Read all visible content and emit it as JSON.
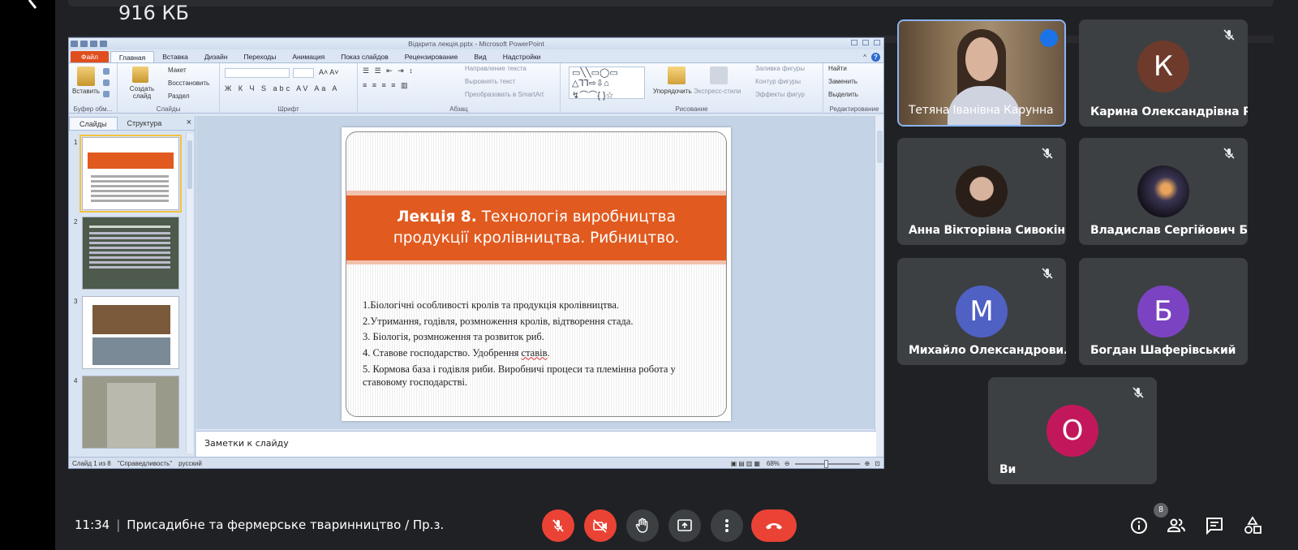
{
  "top": {
    "file_size": "916 КБ"
  },
  "ppt": {
    "window_title": "Відкрита лекція.pptx - Microsoft PowerPoint",
    "tabs": [
      "Файл",
      "Главная",
      "Вставка",
      "Дизайн",
      "Переходы",
      "Анимация",
      "Показ слайдов",
      "Рецензирование",
      "Вид",
      "Надстройки"
    ],
    "ribbon": {
      "clipboard": {
        "paste": "Вставить",
        "label": "Буфер обм..."
      },
      "slides": {
        "create": "Создать слайд",
        "layout": "Макет",
        "reset": "Восстановить",
        "section": "Раздел",
        "label": "Слайды"
      },
      "font": {
        "label": "Шрифт"
      },
      "paragraph": {
        "text_direction": "Направление текста",
        "align_text": "Выровнять текст",
        "convert_smartart": "Преобразовать в SmartArt",
        "label": "Абзац"
      },
      "drawing": {
        "arrange": "Упорядочить",
        "quick_styles": "Экспресс-стили",
        "fill": "Заливка фигуры",
        "outline": "Контур фигуры",
        "effects": "Эффекты фигур",
        "label": "Рисование"
      },
      "editing": {
        "find": "Найти",
        "replace": "Заменить",
        "select": "Выделить",
        "label": "Редактирование"
      }
    },
    "left_pane": {
      "tab_slides": "Слайды",
      "tab_outline": "Структура",
      "close": "×",
      "thumb_numbers": [
        "1",
        "2",
        "3",
        "4"
      ]
    },
    "slide": {
      "title_bold": "Лекція 8.",
      "title_rest_line1": " Технологія виробництва",
      "title_line2": "продукції кролівництва. Рибництво.",
      "items": [
        "1.Біологічні особливості кролів та продукція кролівництва.",
        "2.Утримання, годівля, розмноження кролів, відтворення стада.",
        "3. Біологія, розмноження та розвиток риб."
      ],
      "item4_pre": "4. Ставове господарство. Удобрення ",
      "item4_squiggle": "ставів",
      "item4_post": ".",
      "item5": "5. Кормова база і годівля риби. Виробничі процеси та племінна робота у ставовому господарстві."
    },
    "notes_placeholder": "Заметки к слайду",
    "status": {
      "slide_count": "Слайд 1 из 8",
      "theme": "\"Справедливость\"",
      "language": "русский",
      "zoom": "68%"
    }
  },
  "participants": [
    {
      "name": "Тетяна Іванівна Карунна",
      "video": true
    },
    {
      "name": "Карина Олександрівна Р...",
      "initial": "К",
      "color": "#6d3a2c"
    },
    {
      "name": "Анна Вікторівна Сивокінь",
      "photo": true
    },
    {
      "name": "Владислав Сергійович Б...",
      "photo": true
    },
    {
      "name": "Михайло Олександрови...",
      "initial": "М",
      "color": "#5061c4"
    },
    {
      "name": "Богдан Шаферівський",
      "initial": "Б",
      "color": "#7b43c1"
    },
    {
      "name": "Ви",
      "initial": "О",
      "color": "#c2185b"
    }
  ],
  "bottom": {
    "time": "11:34",
    "meeting_title": "Присадибне та фермерське тваринництво / Пр.з.",
    "participants_count": "8"
  },
  "colors": {
    "accent_red": "#ea4335",
    "tile_bg": "#3c4043",
    "bg": "#202124",
    "slide_orange": "#e15a1f"
  }
}
